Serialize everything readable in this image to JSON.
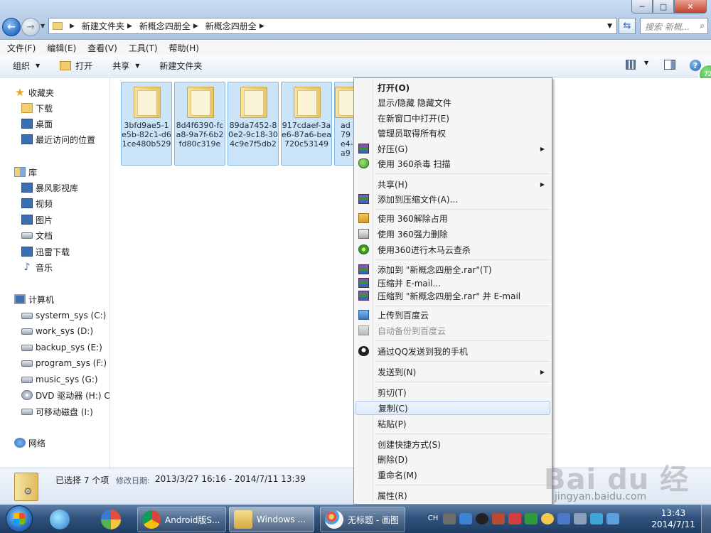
{
  "window": {
    "controls": [
      "─",
      "□",
      "✕"
    ]
  },
  "address": {
    "crumbs": [
      "新建文件夹",
      "新概念四册全",
      "新概念四册全"
    ],
    "search_placeholder": "搜索 新概..."
  },
  "menubar": [
    "文件(F)",
    "编辑(E)",
    "查看(V)",
    "工具(T)",
    "帮助(H)"
  ],
  "toolbar": {
    "organize": "组织",
    "open": "打开",
    "share": "共享",
    "new_folder": "新建文件夹"
  },
  "notification_badge": "72",
  "sidebar": {
    "favorites": {
      "title": "收藏夹",
      "items": [
        "下载",
        "桌面",
        "最近访问的位置"
      ]
    },
    "libraries": {
      "title": "库",
      "items": [
        "暴风影视库",
        "视频",
        "图片",
        "文档",
        "迅雷下载",
        "音乐"
      ]
    },
    "computer": {
      "title": "计算机",
      "items": [
        "systerm_sys (C:)",
        "work_sys (D:)",
        "backup_sys (E:)",
        "program_sys (F:)",
        "music_sys (G:)",
        "DVD 驱动器 (H:) CD",
        "可移动磁盘 (I:)"
      ]
    },
    "network": {
      "title": "网络"
    }
  },
  "folders": [
    "3bfd9ae5-1e5b-82c1-d61ce480b529",
    "8d4f6390-fca8-9a7f-6b2fd80c319e",
    "89da7452-80e2-9c18-304c9e7f5db2",
    "917cdaef-3ae6-87a6-bea720c53149",
    "ad7​9e4​-a9"
  ],
  "context_menu": {
    "items": [
      {
        "label": "打开(O)",
        "bold": true
      },
      {
        "label": "显示/隐藏 隐藏文件"
      },
      {
        "label": "在新窗口中打开(E)"
      },
      {
        "label": "管理员取得所有权"
      },
      {
        "label": "好压(G)",
        "submenu": true,
        "icon": "haozip-icon"
      },
      {
        "label": "使用 360杀毒 扫描",
        "icon": "360-antivirus-icon"
      },
      {
        "label": "共享(H)",
        "submenu": true
      },
      {
        "label": "添加到压缩文件(A)...",
        "icon": "winrar-icon"
      },
      {
        "label": "使用 360解除占用",
        "icon": "360-unlock-icon"
      },
      {
        "label": "使用 360强力删除",
        "icon": "360-shredder-icon"
      },
      {
        "label": "使用360进行木马云查杀",
        "icon": "360-trojan-scan-icon"
      },
      {
        "label": "添加到 \"新概念四册全.rar\"(T)",
        "icon": "winrar-icon"
      },
      {
        "label": "压缩并 E-mail...",
        "icon": "winrar-icon"
      },
      {
        "label": "压缩到 \"新概念四册全.rar\" 并 E-mail",
        "icon": "winrar-icon"
      },
      {
        "label": "上传到百度云",
        "icon": "baidu-cloud-icon"
      },
      {
        "label": "自动备份到百度云",
        "disabled": true,
        "icon": "baidu-cloud-icon"
      },
      {
        "label": "通过QQ发送到我的手机",
        "icon": "qq-icon"
      },
      {
        "label": "发送到(N)",
        "submenu": true
      },
      {
        "label": "剪切(T)"
      },
      {
        "label": "复制(C)",
        "highlighted": true
      },
      {
        "label": "粘贴(P)"
      },
      {
        "label": "创建快捷方式(S)"
      },
      {
        "label": "删除(D)"
      },
      {
        "label": "重命名(M)"
      },
      {
        "label": "属性(R)"
      }
    ]
  },
  "status": {
    "selection": "已选择 7 个项",
    "modified_label": "修改日期:",
    "modified_value": "2013/3/27 16:16 - 2014/7/11 13:39"
  },
  "taskbar": {
    "tasks": [
      "Android版S...",
      "Windows ...",
      "无标题 - 画图"
    ],
    "tray_ime": "CH",
    "time": "13:43",
    "date": "2014/7/11"
  },
  "watermark": {
    "logo": "Bai du 经验",
    "url": "jingyan.baidu.com"
  }
}
